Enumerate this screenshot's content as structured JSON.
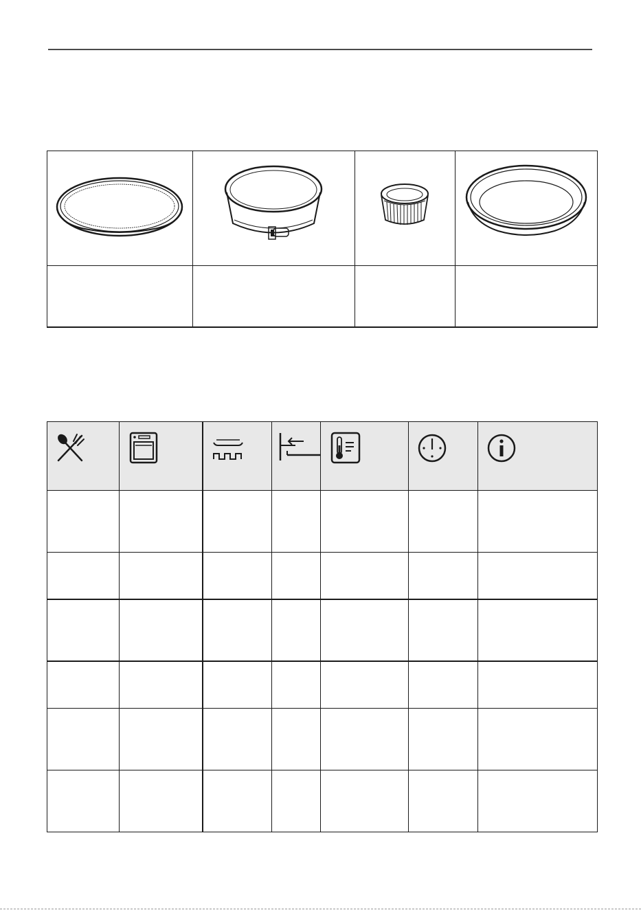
{
  "bakeware": {
    "items": [
      {
        "icon": "flan-base-pan-icon",
        "caption": ""
      },
      {
        "icon": "springform-pan-icon",
        "caption": ""
      },
      {
        "icon": "ramekin-icon",
        "caption": ""
      },
      {
        "icon": "pie-dish-icon",
        "caption": ""
      }
    ]
  },
  "baking_table": {
    "header_icons": [
      "food-cutlery-icon",
      "oven-function-icon",
      "shelf-position-icon",
      "level-icon",
      "temperature-icon",
      "time-icon",
      "info-icon"
    ],
    "rows": [
      [
        "",
        "",
        "",
        "",
        "",
        "",
        ""
      ],
      [
        "",
        "",
        "",
        "",
        "",
        "",
        ""
      ],
      [
        "",
        "",
        "",
        "",
        "",
        "",
        ""
      ],
      [
        "",
        "",
        "",
        "",
        "",
        "",
        ""
      ],
      [
        "",
        "",
        "",
        "",
        "",
        "",
        ""
      ],
      [
        "",
        "",
        "",
        "",
        "",
        "",
        ""
      ]
    ]
  },
  "colors": {
    "line": "#1a1a1a",
    "header_bg": "#e8e8e8",
    "rule": "#4a4a4a"
  }
}
